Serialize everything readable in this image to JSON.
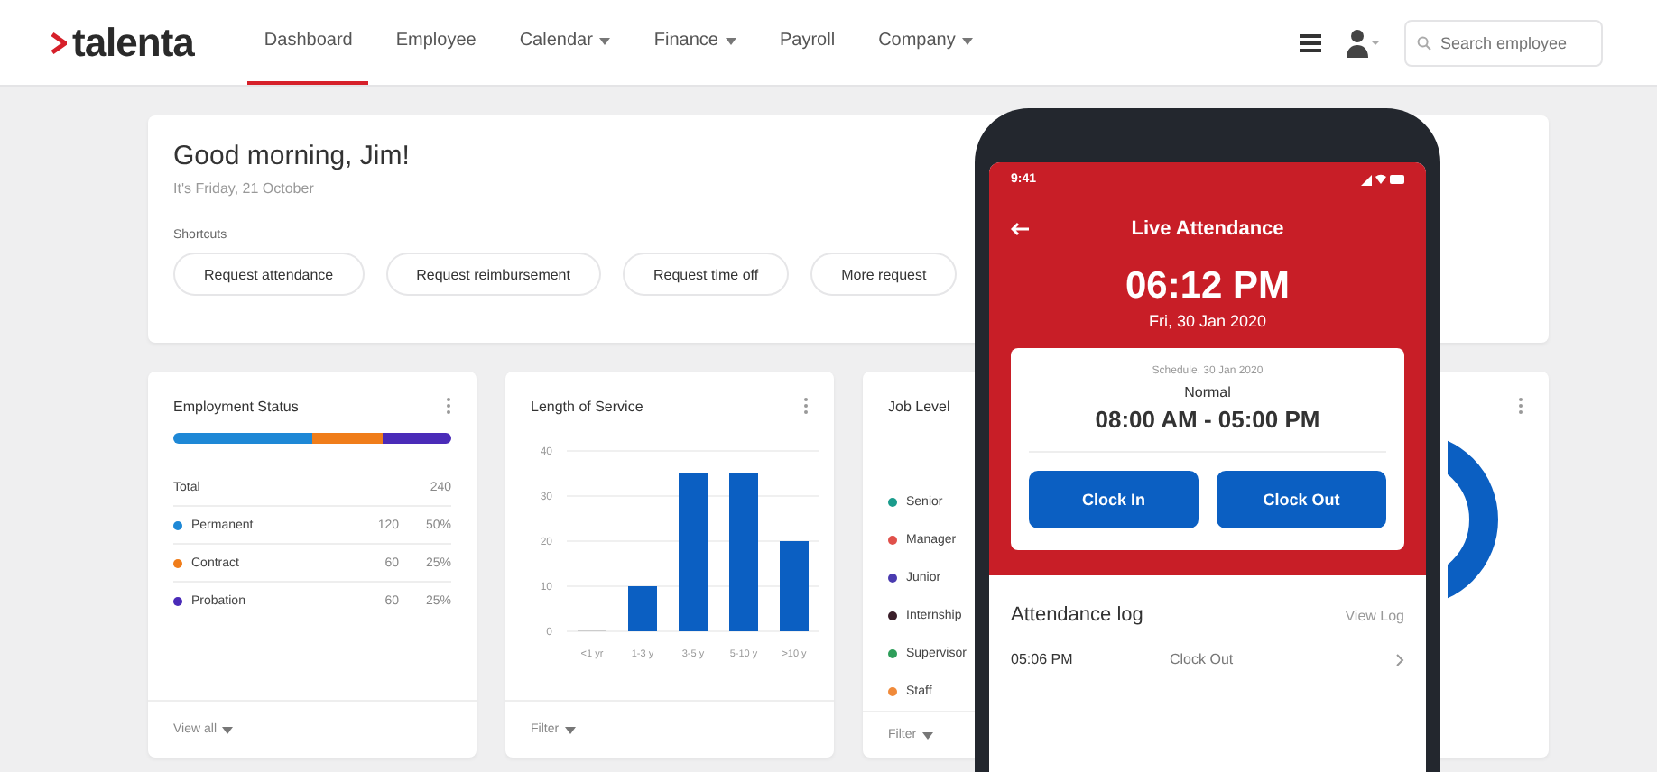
{
  "header": {
    "logo": "talenta",
    "nav": [
      {
        "label": "Dashboard",
        "selected": true,
        "dropdown": false
      },
      {
        "label": "Employee",
        "selected": false,
        "dropdown": false
      },
      {
        "label": "Calendar",
        "selected": false,
        "dropdown": true
      },
      {
        "label": "Finance",
        "selected": false,
        "dropdown": true
      },
      {
        "label": "Payroll",
        "selected": false,
        "dropdown": false
      },
      {
        "label": "Company",
        "selected": false,
        "dropdown": true
      }
    ],
    "search": {
      "placeholder": "Search employee"
    }
  },
  "greeting": {
    "title": "Good morning, Jim!",
    "subtitle": "It's Friday, 21 October",
    "shortcuts_label": "Shortcuts",
    "shortcuts": [
      "Request attendance",
      "Request reimbursement",
      "Request time off",
      "More request"
    ]
  },
  "employment_status": {
    "title": "Employment Status",
    "total_label": "Total",
    "total": "240",
    "rows": [
      {
        "label": "Permanent",
        "count": "120",
        "share": "50%",
        "color": "#1e88d6"
      },
      {
        "label": "Contract",
        "count": "60",
        "share": "25%",
        "color": "#f07d1a"
      },
      {
        "label": "Probation",
        "count": "60",
        "share": "25%",
        "color": "#4a2bb8"
      }
    ],
    "footer": "View all"
  },
  "length_of_service": {
    "title": "Length of Service",
    "footer": "Filter",
    "chart_data": {
      "type": "bar",
      "categories": [
        "<1 yr",
        "1-3 y",
        "3-5 y",
        "5-10 y",
        ">10 y"
      ],
      "values": [
        0,
        10,
        35,
        35,
        20
      ],
      "yticks": [
        0,
        10,
        20,
        30,
        40
      ],
      "ylim": [
        0,
        40
      ],
      "grid": true
    }
  },
  "job_level": {
    "title": "Job Level",
    "legend": [
      {
        "label": "Senior",
        "color": "#1a9c8c"
      },
      {
        "label": "Manager",
        "color": "#e0504a"
      },
      {
        "label": "Junior",
        "color": "#4a3bb0"
      },
      {
        "label": "Internship",
        "color": "#3a1f2a"
      },
      {
        "label": "Supervisor",
        "color": "#2e9e5a"
      },
      {
        "label": "Staff",
        "color": "#f08a3a"
      }
    ],
    "footer": "Filter"
  },
  "phone": {
    "status_time": "9:41",
    "title": "Live Attendance",
    "time": "06:12 PM",
    "date": "Fri, 30 Jan 2020",
    "schedule": {
      "date": "Schedule, 30 Jan 2020",
      "shift": "Normal",
      "hours": "08:00 AM - 05:00 PM"
    },
    "buttons": [
      "Clock In",
      "Clock Out"
    ],
    "log": {
      "title": "Attendance log",
      "link": "View Log",
      "rows": [
        {
          "time": "05:06 PM",
          "action": "Clock Out"
        }
      ]
    }
  }
}
